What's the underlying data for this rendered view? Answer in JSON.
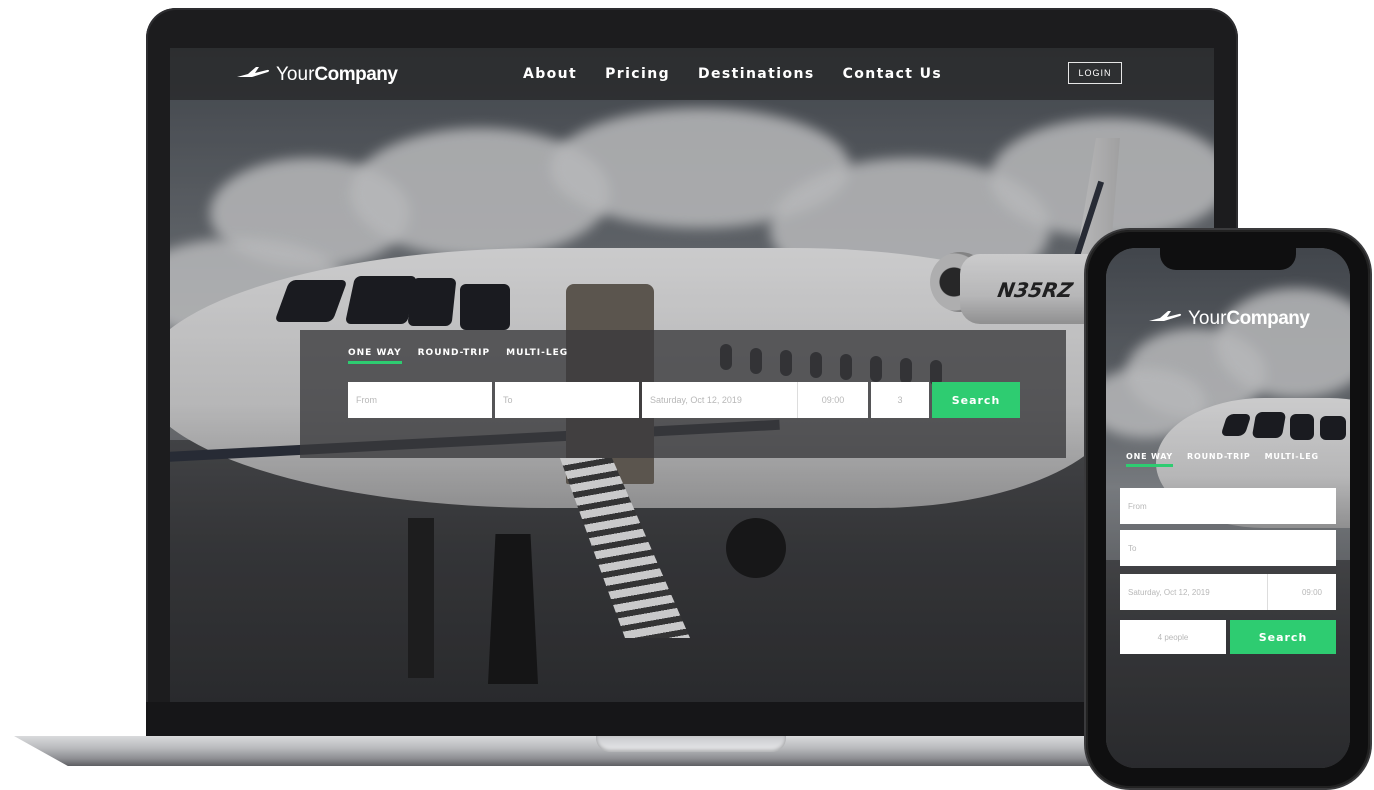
{
  "brand": {
    "light": "Your",
    "bold": "Company",
    "icon": "plane-icon"
  },
  "nav": {
    "items": [
      {
        "label": "About"
      },
      {
        "label": "Pricing"
      },
      {
        "label": "Destinations"
      },
      {
        "label": "Contact Us"
      }
    ],
    "login_label": "LOGIN"
  },
  "booking": {
    "tabs": [
      {
        "label": "ONE WAY",
        "active": true
      },
      {
        "label": "ROUND-TRIP",
        "active": false
      },
      {
        "label": "MULTI-LEG",
        "active": false
      }
    ],
    "from_placeholder": "From",
    "to_placeholder": "To",
    "date": "Saturday, Oct 12, 2019",
    "time": "09:00",
    "passengers": "3",
    "search_label": "Search"
  },
  "mobile": {
    "from_placeholder": "From",
    "to_placeholder": "To",
    "date": "Saturday, Oct 12, 2019",
    "time": "09:00",
    "passengers": "4 people",
    "search_label": "Search"
  },
  "aircraft_registration": "N35RZ",
  "colors": {
    "accent": "#2ecc71",
    "nav_bg": "#28292b",
    "panel_bg": "#3a3a3c"
  }
}
